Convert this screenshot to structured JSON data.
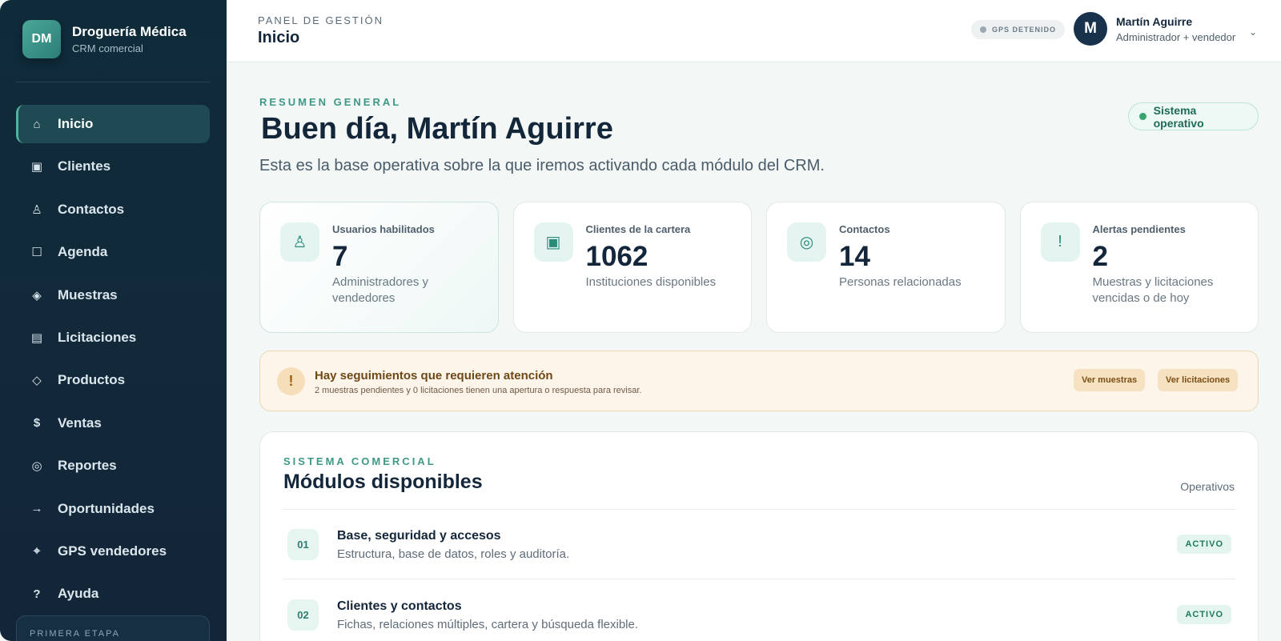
{
  "brand": {
    "logo_initials": "DM",
    "name": "Droguería Médica",
    "subtitle": "CRM comercial"
  },
  "sidebar": {
    "items": [
      {
        "label": "Inicio",
        "icon": "home-icon",
        "active": true
      },
      {
        "label": "Clientes",
        "icon": "building-icon"
      },
      {
        "label": "Contactos",
        "icon": "person-icon"
      },
      {
        "label": "Agenda",
        "icon": "calendar-icon"
      },
      {
        "label": "Muestras",
        "icon": "diamond-icon"
      },
      {
        "label": "Licitaciones",
        "icon": "document-icon"
      },
      {
        "label": "Productos",
        "icon": "tag-icon"
      },
      {
        "label": "Ventas",
        "icon": "dollar-icon"
      },
      {
        "label": "Reportes",
        "icon": "chart-icon"
      },
      {
        "label": "Oportunidades",
        "icon": "arrow-right-icon"
      },
      {
        "label": "GPS vendedores",
        "icon": "location-icon"
      },
      {
        "label": "Ayuda",
        "icon": "help-icon"
      }
    ],
    "stage_label": "PRIMERA ETAPA"
  },
  "header": {
    "breadcrumb": "PANEL DE GESTIÓN",
    "title": "Inicio",
    "gps_status": "GPS DETENIDO",
    "user": {
      "initial": "M",
      "name": "Martín Aguirre",
      "role": "Administrador + vendedor"
    }
  },
  "hero": {
    "eyebrow": "RESUMEN GENERAL",
    "greeting": "Buen día, Martín Aguirre",
    "subtitle": "Esta es la base operativa sobre la que iremos activando cada módulo del CRM.",
    "system_status": "Sistema operativo"
  },
  "stats": [
    {
      "label": "Usuarios habilitados",
      "value": "7",
      "description": "Administradores y vendedores",
      "icon": "person-icon"
    },
    {
      "label": "Clientes de la cartera",
      "value": "1062",
      "description": "Instituciones disponibles",
      "icon": "building-icon"
    },
    {
      "label": "Contactos",
      "value": "14",
      "description": "Personas relacionadas",
      "icon": "target-icon"
    },
    {
      "label": "Alertas pendientes",
      "value": "2",
      "description": "Muestras y licitaciones vencidas o de hoy",
      "icon": "alert-icon"
    }
  ],
  "alert": {
    "title": "Hay seguimientos que requieren atención",
    "text": "2 muestras pendientes y 0 licitaciones tienen una apertura o respuesta para revisar.",
    "buttons": [
      "Ver muestras",
      "Ver licitaciones"
    ]
  },
  "modules": {
    "eyebrow": "SISTEMA COMERCIAL",
    "title": "Módulos disponibles",
    "count_label": "Operativos",
    "items": [
      {
        "number": "01",
        "name": "Base, seguridad y accesos",
        "description": "Estructura, base de datos, roles y auditoría.",
        "status": "ACTIVO"
      },
      {
        "number": "02",
        "name": "Clientes y contactos",
        "description": "Fichas, relaciones múltiples, cartera y búsqueda flexible.",
        "status": "ACTIVO"
      }
    ]
  },
  "colors": {
    "accent": "#3e9885",
    "sidebar_bg": "#12293a",
    "warning_bg": "#fdf5ea"
  }
}
